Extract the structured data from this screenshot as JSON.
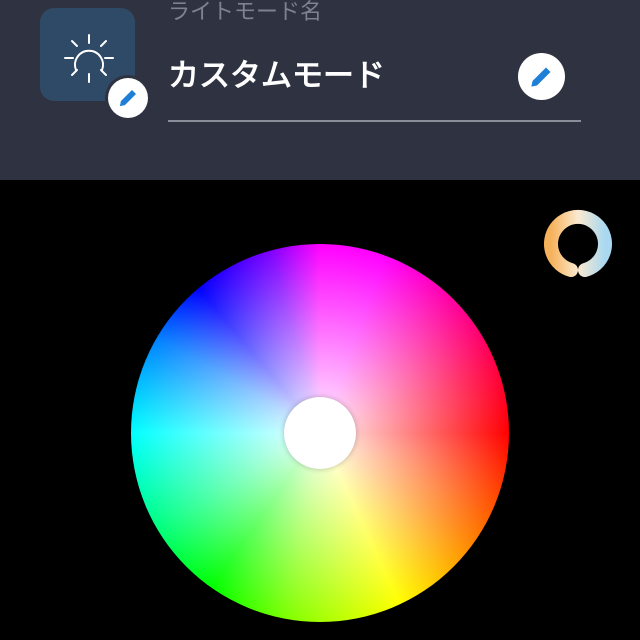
{
  "header": {
    "name_label": "ライトモード名",
    "name_value": "カスタムモード",
    "icon": "sun-icon",
    "edit_icon": "pencil-icon"
  },
  "toggle": {
    "icon": "power-ring-icon"
  },
  "color_picker": {
    "selected_color": "#ffffff"
  },
  "colors": {
    "header_bg": "#2f3240",
    "icon_tile_bg": "#2e4a66",
    "accent": "#1f7fd6",
    "background": "#000000"
  }
}
